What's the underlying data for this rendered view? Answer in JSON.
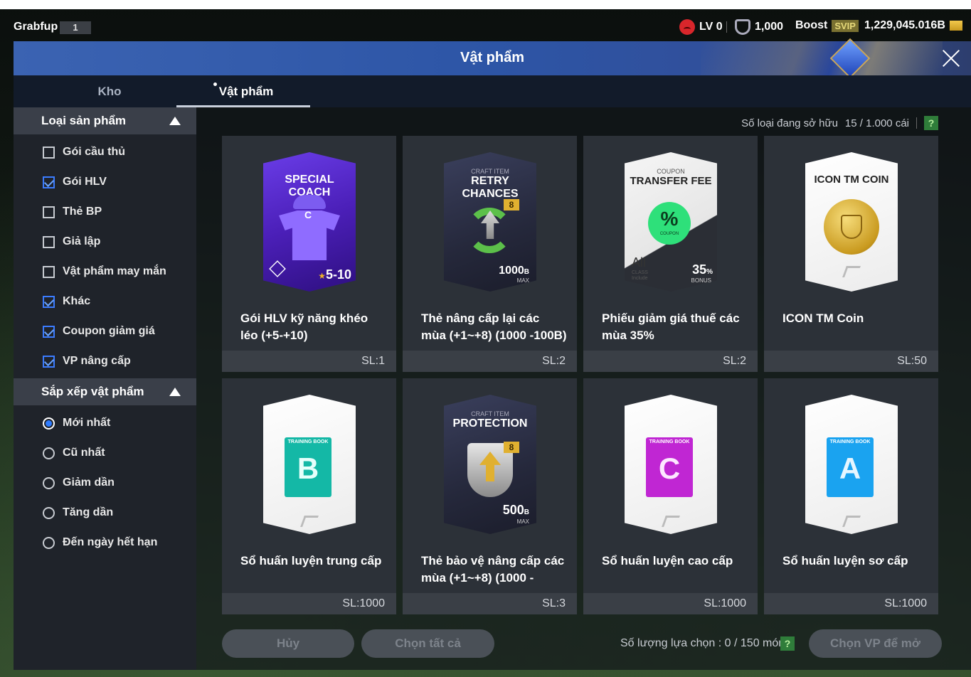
{
  "topbar": {
    "username": "Grabfup",
    "user_level": "1",
    "lv": "LV 0",
    "shield_count": "1,000",
    "boost": "Boost",
    "svip": "SVIP",
    "currency": "1,229,045.016B"
  },
  "window": {
    "title": "Vật phẩm"
  },
  "tabs": [
    {
      "label": "Kho",
      "active": false
    },
    {
      "label": "Vật phẩm",
      "active": true
    }
  ],
  "filters": {
    "product_type_title": "Loại sản phẩm",
    "product_types": [
      {
        "label": "Gói cầu thủ",
        "checked": false
      },
      {
        "label": "Gói HLV",
        "checked": true
      },
      {
        "label": "Thẻ BP",
        "checked": false
      },
      {
        "label": "Giả lập",
        "checked": false
      },
      {
        "label": "Vật phẩm may mắn",
        "checked": false
      },
      {
        "label": "Khác",
        "checked": true
      },
      {
        "label": "Coupon giảm giá",
        "checked": true
      },
      {
        "label": "VP nâng cấp",
        "checked": true
      }
    ],
    "sort_title": "Sắp xếp vật phẩm",
    "sort_options": [
      {
        "label": "Mới nhất",
        "selected": true
      },
      {
        "label": "Cũ nhất",
        "selected": false
      },
      {
        "label": "Giảm dần",
        "selected": false
      },
      {
        "label": "Tăng dần",
        "selected": false
      },
      {
        "label": "Đến ngày hết hạn",
        "selected": false
      }
    ]
  },
  "owned": {
    "label": "Số loại đang sở hữu",
    "value": "15 / 1.000 cái",
    "help": "?"
  },
  "items": [
    {
      "name": "Gói HLV kỹ năng khéo léo (+5-+10)",
      "qty": "SL:1",
      "card": {
        "title": "SPECIAL COACH",
        "tag": "",
        "range": "5-10",
        "star": "★",
        "style": "coach",
        "letter": "C"
      }
    },
    {
      "name": "Thẻ nâng cấp lại các mùa (+1~+8) (1000 -100B)",
      "qty": "SL:2",
      "card": {
        "title": "RETRY CHANCES",
        "tag": "CRAFT ITEM",
        "amount": "1000",
        "unit": "B",
        "max": "MAX",
        "badge": "8",
        "style": "craft"
      }
    },
    {
      "name": "Phiếu giảm giá thuế các mùa 35%",
      "qty": "SL:2",
      "card": {
        "title": "TRANSFER FEE",
        "tag": "COUPON",
        "pct": "%",
        "coupon": "COUPON",
        "all": "All",
        "cls": "CLASS",
        "include": "Include",
        "bonus_value": "35",
        "bonus_unit": "%",
        "bonus": "BONUS",
        "style": "coupon"
      }
    },
    {
      "name": "ICON TM Coin",
      "qty": "SL:50",
      "card": {
        "title": "ICON TM COIN",
        "style": "coin"
      }
    },
    {
      "name": "Sổ huấn luyện trung cấp",
      "qty": "SL:1000",
      "card": {
        "tag": "TRAINING BOOK",
        "letter": "B",
        "color": "#14b8a6",
        "style": "book"
      }
    },
    {
      "name": "Thẻ bảo vệ nâng cấp các mùa (+1~+8) (1000 -",
      "qty": "SL:3",
      "card": {
        "title": "PROTECTION",
        "tag": "CRAFT ITEM",
        "amount": "500",
        "unit": "B",
        "max": "MAX",
        "badge": "8",
        "style": "protect"
      }
    },
    {
      "name": "Sổ huấn luyện cao cấp",
      "qty": "SL:1000",
      "card": {
        "tag": "TRAINING BOOK",
        "letter": "C",
        "color": "#c026d3",
        "style": "book"
      }
    },
    {
      "name": "Sổ huấn luyện sơ cấp",
      "qty": "SL:1000",
      "card": {
        "tag": "TRAINING BOOK",
        "letter": "A",
        "color": "#1aa3f0",
        "style": "book"
      }
    }
  ],
  "footer": {
    "cancel": "Hủy",
    "select_all": "Chọn tất cả",
    "selection_label": "Số lượng lựa chọn : 0 / 150 món",
    "help": "?",
    "open": "Chọn VP để mở"
  }
}
